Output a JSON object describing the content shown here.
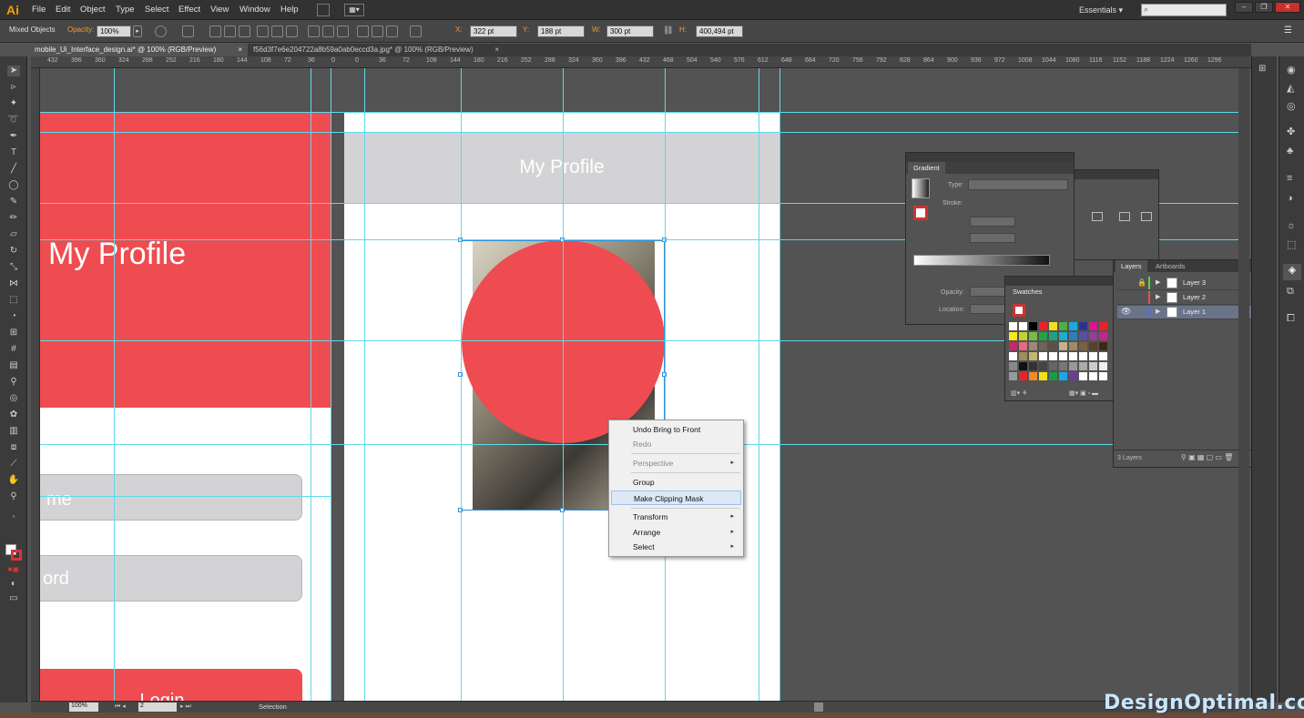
{
  "app": {
    "logo": "Ai"
  },
  "menu": [
    "File",
    "Edit",
    "Object",
    "Type",
    "Select",
    "Effect",
    "View",
    "Window",
    "Help"
  ],
  "workspace": {
    "label": "Essentials",
    "arrow": "▾"
  },
  "control_bar": {
    "selection_label": "Mixed Objects",
    "opacity_label": "Opacity:",
    "opacity_value": "100%",
    "x_label": "X:",
    "x_value": "322 pt",
    "y_label": "Y:",
    "y_value": "188 pt",
    "w_label": "W:",
    "w_value": "300 pt",
    "h_label": "H:",
    "h_value": "400,494 pt"
  },
  "tabs": [
    {
      "label": "mobile_Ui_Interface_design.ai* @ 100% (RGB/Preview)",
      "close": "×"
    },
    {
      "label": "f56d3f7e6e204722a8b59a0ab0eccd3a.jpg* @ 100% (RGB/Preview)",
      "close": "×"
    }
  ],
  "ruler_labels": [
    "432",
    "396",
    "360",
    "324",
    "288",
    "252",
    "216",
    "180",
    "144",
    "108",
    "72",
    "36",
    "0",
    "0",
    "36",
    "72",
    "108",
    "144",
    "180",
    "216",
    "252",
    "288",
    "324",
    "360",
    "396",
    "432",
    "468",
    "504",
    "540",
    "576",
    "612",
    "648",
    "684",
    "720",
    "756",
    "792",
    "828",
    "864",
    "900",
    "936",
    "972",
    "1008",
    "1044",
    "1080",
    "1116",
    "1152",
    "1188",
    "1224",
    "1260",
    "1296"
  ],
  "left_artboard": {
    "title": "My Profile",
    "field1": "me",
    "field2": "ord",
    "button": "Login"
  },
  "right_artboard": {
    "header_title": "My Profile"
  },
  "context_menu": {
    "items": [
      {
        "label": "Undo Bring to Front",
        "disabled": false,
        "submenu": false
      },
      {
        "label": "Redo",
        "disabled": true,
        "submenu": false
      },
      {
        "label": "Perspective",
        "disabled": true,
        "submenu": true
      },
      {
        "label": "Group",
        "disabled": false,
        "submenu": false
      },
      {
        "label": "Make Clipping Mask",
        "disabled": false,
        "submenu": false,
        "highlighted": true
      },
      {
        "label": "Transform",
        "disabled": false,
        "submenu": true
      },
      {
        "label": "Arrange",
        "disabled": false,
        "submenu": true
      },
      {
        "label": "Select",
        "disabled": false,
        "submenu": true
      }
    ],
    "submenu_arrow": "▸"
  },
  "gradient_panel": {
    "title": "Gradient",
    "type_label": "Type:",
    "stroke_label": "Stroke:",
    "opacity_label": "Opacity:",
    "location_label": "Location:"
  },
  "swatches_panel": {
    "title": "Swatches"
  },
  "layers_panel": {
    "tabs": [
      "Layers",
      "Artboards"
    ],
    "layers": [
      {
        "name": "Layer 3",
        "color": "#4fd64f",
        "locked": true,
        "visible": false
      },
      {
        "name": "Layer 2",
        "color": "#ee4c50",
        "locked": false,
        "visible": false
      },
      {
        "name": "Layer 1",
        "color": "#4f6fe0",
        "locked": false,
        "visible": true
      }
    ],
    "footer": "3 Layers"
  },
  "status_bar": {
    "zoom": "100%",
    "artboard_num": "2",
    "tool": "Selection"
  },
  "watermark": "DesignOptimal.com",
  "colors": {
    "accent_red": "#ee4c50",
    "guide_cyan": "#5ed9e8",
    "header_gray": "#d3d3d5"
  }
}
